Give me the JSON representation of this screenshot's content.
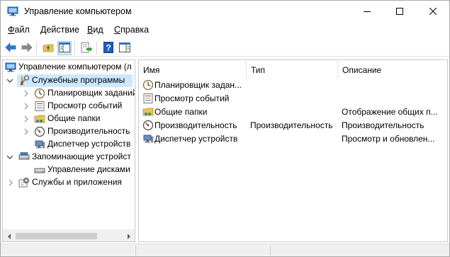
{
  "window": {
    "title": "Управление компьютером",
    "icon": "computer-management-icon"
  },
  "menu": [
    {
      "label_u": "Ф",
      "label_rest": "айл"
    },
    {
      "label_u": "Д",
      "label_rest": "ействие"
    },
    {
      "label_u": "В",
      "label_rest": "ид"
    },
    {
      "label_u": "С",
      "label_rest": "правка"
    }
  ],
  "toolbar": {
    "buttons": [
      "back-arrow-icon",
      "forward-arrow-icon",
      "up-folder-icon",
      "show-hide-tree-icon",
      "export-list-icon",
      "help-icon",
      "properties-pane-icon"
    ]
  },
  "tree": {
    "root": "Управление компьютером (л",
    "items": [
      {
        "label": "Служебные программы",
        "icon": "tools-icon",
        "expanded": true,
        "selected": true
      },
      {
        "label": "Планировщик заданий",
        "icon": "clock-icon"
      },
      {
        "label": "Просмотр событий",
        "icon": "event-viewer-icon"
      },
      {
        "label": "Общие папки",
        "icon": "shared-folder-icon"
      },
      {
        "label": "Производительность",
        "icon": "performance-icon"
      },
      {
        "label": "Диспетчер устройств",
        "icon": "device-manager-icon"
      },
      {
        "label": "Запоминающие устройст",
        "icon": "storage-icon",
        "expanded": true
      },
      {
        "label": "Управление дисками",
        "icon": "disk-icon"
      },
      {
        "label": "Службы и приложения",
        "icon": "services-icon"
      }
    ]
  },
  "list": {
    "columns": [
      "Имя",
      "Тип",
      "Описание"
    ],
    "rows": [
      {
        "name": "Планировщик задан...",
        "type": "",
        "desc": "",
        "icon": "clock-icon"
      },
      {
        "name": "Просмотр событий",
        "type": "",
        "desc": "",
        "icon": "event-viewer-icon"
      },
      {
        "name": "Общие папки",
        "type": "",
        "desc": "Отображение общих п...",
        "icon": "shared-folder-icon"
      },
      {
        "name": "Производительность",
        "type": "Производительность",
        "desc": "Производительность",
        "icon": "performance-icon"
      },
      {
        "name": "Диспетчер устройств",
        "type": "",
        "desc": "Просмотр и обновлен...",
        "icon": "device-manager-icon"
      }
    ]
  },
  "colors": {
    "selection": "#cce8ff",
    "accent_blue": "#1e6fd0",
    "border": "#c9c9c9"
  }
}
